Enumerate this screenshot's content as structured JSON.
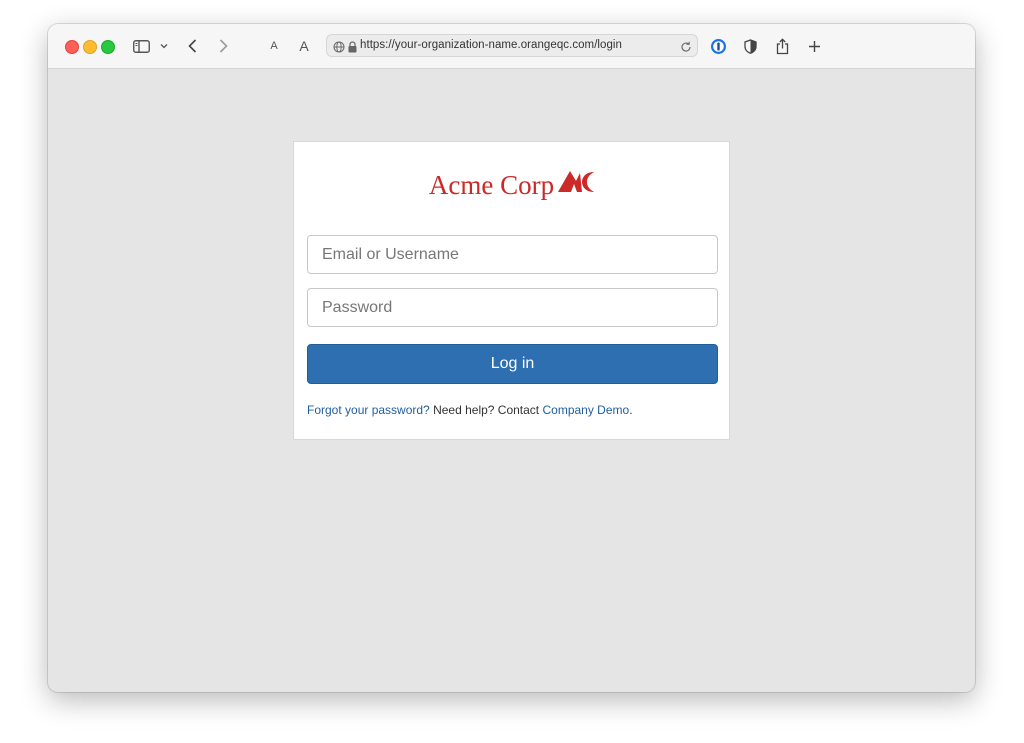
{
  "browser": {
    "url": "https://your-organization-name.orangeqc.com/login",
    "font_small_label": "A",
    "font_large_label": "A",
    "icons": [
      "sidebar-icon",
      "chevron-down-icon",
      "back-icon",
      "forward-icon",
      "globe-icon",
      "lock-icon",
      "reload-icon",
      "password-manager-icon",
      "privacy-shield-icon",
      "share-icon",
      "new-tab-icon"
    ]
  },
  "login": {
    "logo_text": "Acme Corp",
    "email_placeholder": "Email or Username",
    "password_placeholder": "Password",
    "login_label": "Log in",
    "forgot_link": "Forgot your password?",
    "help_text": " Need help? Contact ",
    "company_link": "Company Demo",
    "period": "."
  },
  "colors": {
    "brand_red": "#cc2929",
    "button_blue": "#2d6fb0",
    "link_blue": "#1f5fa0",
    "page_bg": "#e5e5e5"
  }
}
